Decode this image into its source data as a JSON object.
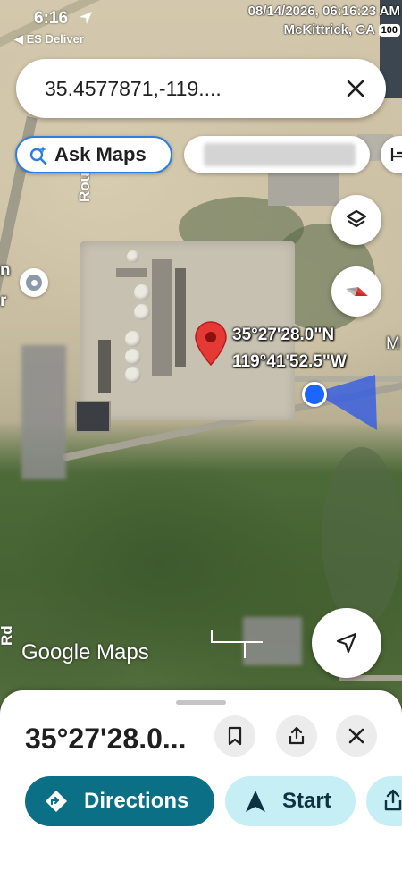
{
  "status_bar": {
    "time": "6:16",
    "back_app": "◀ ES Deliver",
    "timestamp": "08/14/2026, 06:16:23 AM",
    "location": "McKittrick, CA",
    "battery": "100"
  },
  "search": {
    "query": "35.4577871,-119...."
  },
  "chips": {
    "ask_maps": "Ask Maps"
  },
  "map": {
    "pin_lat": "35°27'28.0\"N",
    "pin_lng": "119°41'52.5\"W",
    "road_label": "Rou",
    "road_label_2": "Rd",
    "left_label_1": "n",
    "left_label_2": "r",
    "right_label_1": "M",
    "attribution": "Google Maps"
  },
  "sheet": {
    "title": "35°27'28.0...",
    "directions_label": "Directions",
    "start_label": "Start"
  },
  "colors": {
    "primary": "#0b7085",
    "start_bg": "#c6eef5",
    "pin": "#e53935",
    "location_dot": "#1a66ff",
    "ask_border": "#2a7fe0"
  }
}
